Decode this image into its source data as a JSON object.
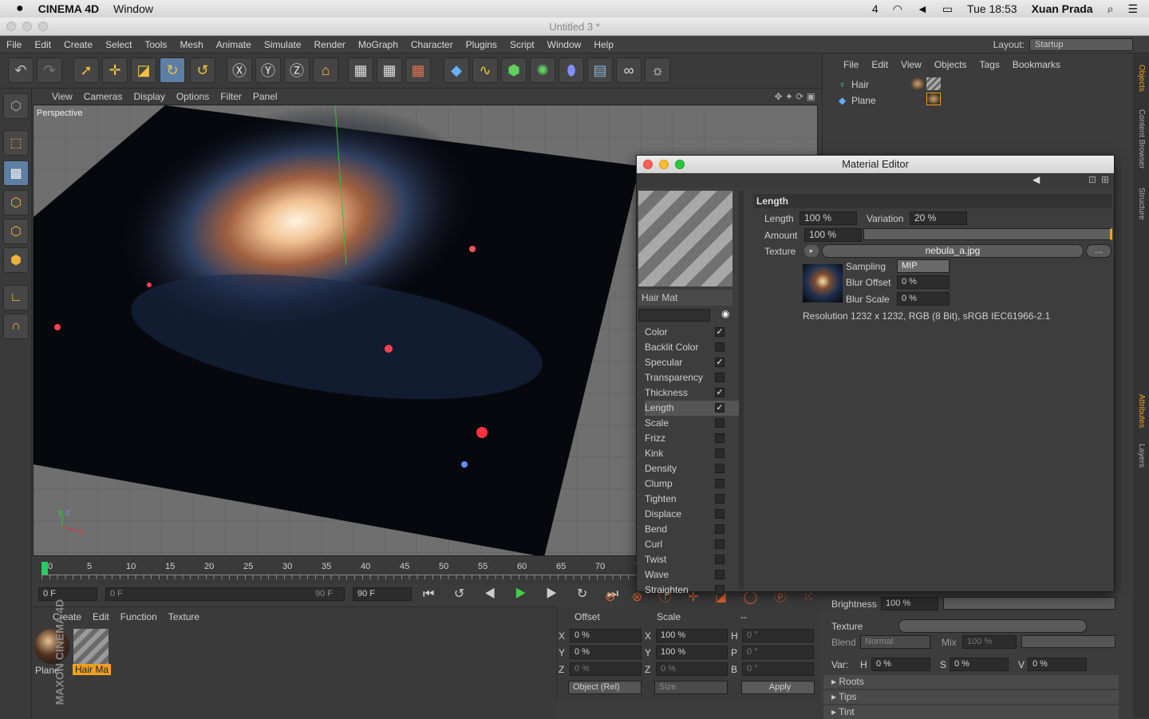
{
  "macos": {
    "app": "CINEMA 4D",
    "menu": "Window",
    "indicator": "4",
    "clock": "Tue 18:53",
    "user": "Xuan Prada"
  },
  "window": {
    "title": "Untitled 3 *"
  },
  "menubar": [
    "File",
    "Edit",
    "Create",
    "Select",
    "Tools",
    "Mesh",
    "Animate",
    "Simulate",
    "Render",
    "MoGraph",
    "Character",
    "Plugins",
    "Script",
    "Window",
    "Help"
  ],
  "layout": {
    "label": "Layout:",
    "value": "Startup"
  },
  "viewport": {
    "menu": [
      "View",
      "Cameras",
      "Display",
      "Options",
      "Filter",
      "Panel"
    ],
    "label": "Perspective",
    "axis_y": "Y",
    "axis_z": "Z",
    "axis_x": "X"
  },
  "timeline": {
    "ticks": [
      "0",
      "5",
      "10",
      "15",
      "20",
      "25",
      "30",
      "35",
      "40",
      "45",
      "50",
      "55",
      "60",
      "65",
      "70",
      "75"
    ],
    "start": "0 F",
    "range_start": "0 F",
    "range_end": "90 F",
    "end": "90 F"
  },
  "material_manager": {
    "menu": [
      "Create",
      "Edit",
      "Function",
      "Texture"
    ],
    "materials": [
      "Plane",
      "Hair Ma"
    ],
    "brand": "MAXON CINEMA 4D"
  },
  "coords": {
    "headers": [
      "Offset",
      "Scale",
      "--"
    ],
    "rows": [
      {
        "a": "X",
        "v1": "0 %",
        "b": "X",
        "v2": "100 %",
        "c": "H",
        "v3": "0 °"
      },
      {
        "a": "Y",
        "v1": "0 %",
        "b": "Y",
        "v2": "100 %",
        "c": "P",
        "v3": "0 °"
      },
      {
        "a": "Z",
        "v1": "0 %",
        "b": "Z",
        "v2": "0 %",
        "c": "B",
        "v3": "0 °"
      }
    ],
    "mode": "Object (Rel)",
    "size": "Size",
    "apply": "Apply"
  },
  "objects": {
    "menu": [
      "File",
      "Edit",
      "View",
      "Objects",
      "Tags",
      "Bookmarks"
    ],
    "items": [
      "Hair",
      "Plane"
    ]
  },
  "right_tabs": [
    "Objects",
    "Content Browser",
    "Structure",
    "Attributes",
    "Layers"
  ],
  "material_editor": {
    "title": "Material Editor",
    "mat_name": "Hair Mat",
    "channels": [
      {
        "n": "Color",
        "c": true
      },
      {
        "n": "Backlit Color",
        "c": false
      },
      {
        "n": "Specular",
        "c": true
      },
      {
        "n": "Transparency",
        "c": false
      },
      {
        "n": "Thickness",
        "c": true
      },
      {
        "n": "Length",
        "c": true
      },
      {
        "n": "Scale",
        "c": false
      },
      {
        "n": "Frizz",
        "c": false
      },
      {
        "n": "Kink",
        "c": false
      },
      {
        "n": "Density",
        "c": false
      },
      {
        "n": "Clump",
        "c": false
      },
      {
        "n": "Tighten",
        "c": false
      },
      {
        "n": "Displace",
        "c": false
      },
      {
        "n": "Bend",
        "c": false
      },
      {
        "n": "Curl",
        "c": false
      },
      {
        "n": "Twist",
        "c": false
      },
      {
        "n": "Wave",
        "c": false
      },
      {
        "n": "Straighten",
        "c": false
      }
    ],
    "section": "Length",
    "length_label": "Length",
    "length_val": "100 %",
    "variation_label": "Variation",
    "variation_val": "20 %",
    "amount_label": "Amount",
    "amount_val": "100 %",
    "texture_label": "Texture",
    "texture_file": "nebula_a.jpg",
    "browse": "...",
    "sampling_label": "Sampling",
    "sampling_val": "MIP",
    "bluroff_label": "Blur Offset",
    "bluroff_val": "0 %",
    "blurscale_label": "Blur Scale",
    "blurscale_val": "0 %",
    "resolution": "Resolution 1232 x 1232, RGB (8 Bit), sRGB IEC61966-2.1"
  },
  "attr_lower": {
    "brightness_label": "Brightness",
    "brightness_val": "100 %",
    "texture_label": "Texture",
    "blend_label": "Blend",
    "blend_val": "Normal",
    "mix_label": "Mix",
    "mix_val": "100 %",
    "var_label": "Var:",
    "h": "H",
    "h_val": "0 %",
    "s": "S",
    "s_val": "0 %",
    "v": "V",
    "v_val": "0 %",
    "groups": [
      "Roots",
      "Tips",
      "Tint"
    ]
  }
}
